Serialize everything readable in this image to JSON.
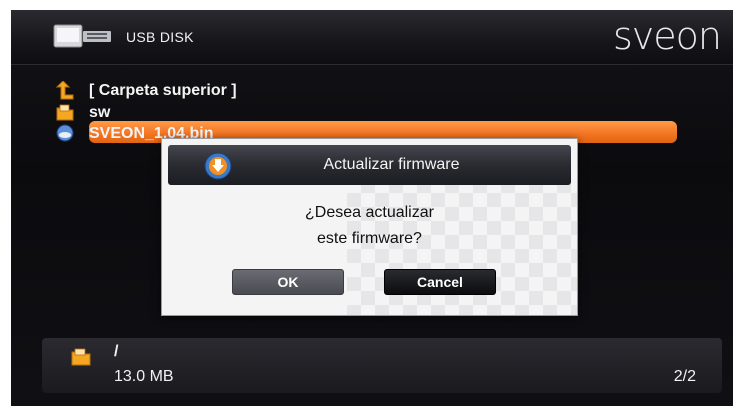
{
  "header": {
    "device_label": "USB DISK",
    "brand": "sveon"
  },
  "file_list": {
    "items": [
      {
        "label": "[ Carpeta superior ]",
        "icon": "folder-up-arrow-icon"
      },
      {
        "label": "sw",
        "icon": "folder-icon"
      },
      {
        "label": "SVEON_1.04.bin",
        "icon": "firmware-file-icon",
        "selected": true
      }
    ],
    "highlight_color": "#f27421"
  },
  "dialog": {
    "title": "Actualizar firmware",
    "message_line1": "¿Desea actualizar",
    "message_line2": "este firmware?",
    "ok_label": "OK",
    "cancel_label": "Cancel",
    "icon": "firmware-download-icon"
  },
  "footer": {
    "path": "/",
    "size": "13.0 MB",
    "page": "2/2",
    "icon": "folder-icon"
  }
}
